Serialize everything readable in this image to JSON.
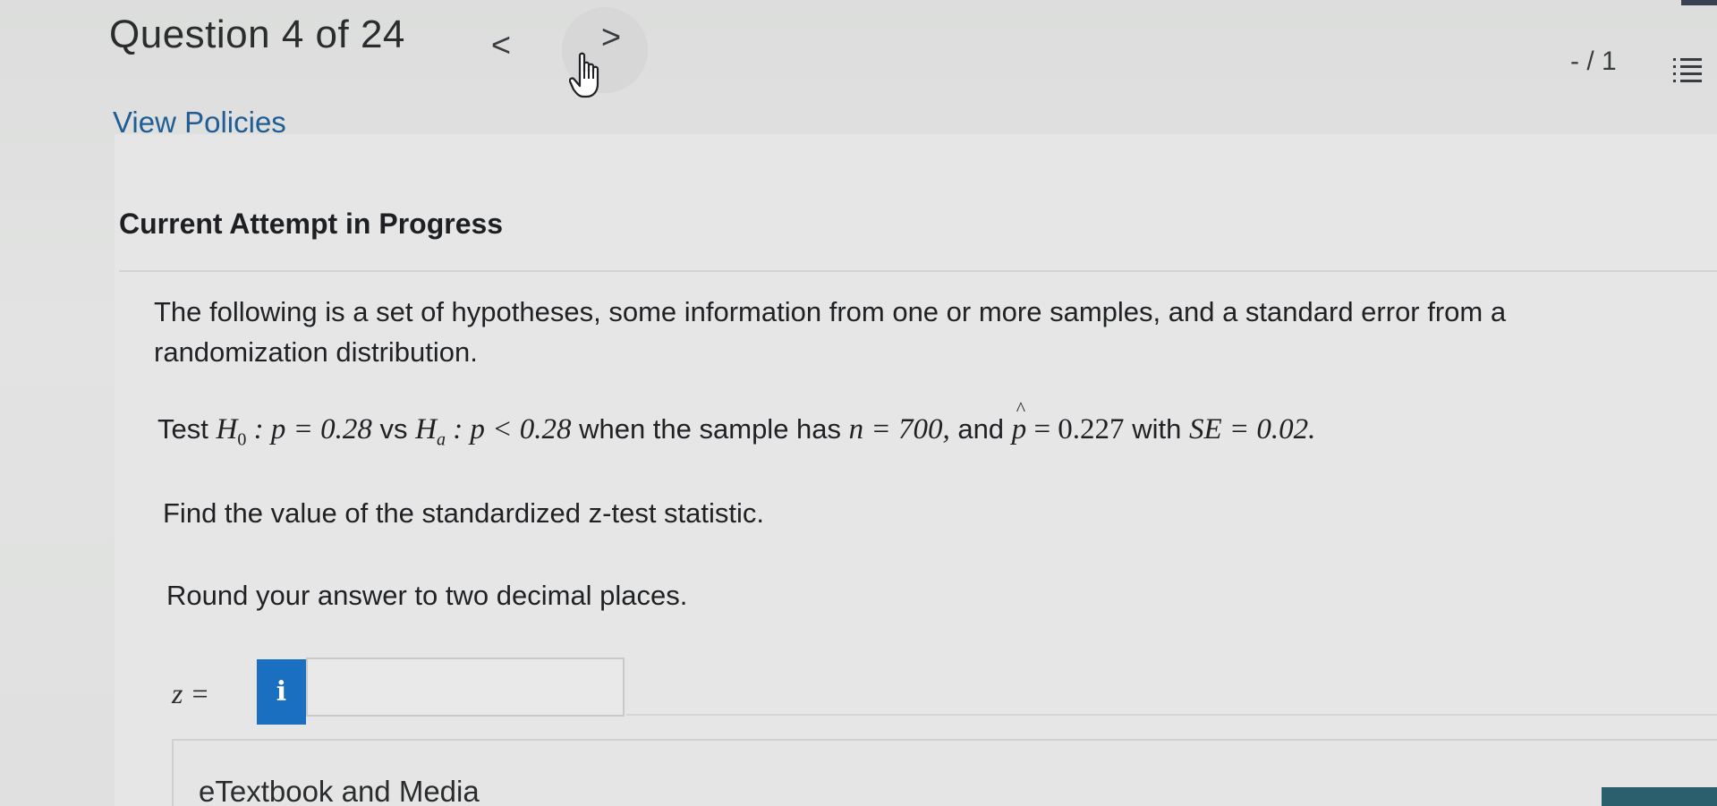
{
  "header": {
    "question_label": "Question 4 of 24",
    "prev_label": "<",
    "next_label": ">",
    "score": "- / 1",
    "menu_icon": "list-icon"
  },
  "links": {
    "view_policies": "View Policies"
  },
  "attempt": {
    "heading": "Current Attempt in Progress"
  },
  "question": {
    "intro": "The following is a set of hypotheses, some information from one or more samples, and a standard error from a randomization distribution.",
    "test_prefix": "Test",
    "h0_symbol": "H",
    "h0_sub": "0",
    "h0_expr": ": p = 0.28",
    "vs": "vs",
    "ha_symbol": "H",
    "ha_sub": "a",
    "ha_expr": ": p < 0.28",
    "when_text": "when the sample has",
    "n_expr": "n = 700,",
    "and_text": "and",
    "phat_symbol": "p",
    "phat_expr": "= 0.227",
    "with_text": "with",
    "se_expr": "SE = 0.02.",
    "find_text": "Find the value of the standardized z-test statistic.",
    "round_text": "Round your answer to two decimal places."
  },
  "answer": {
    "label": "z =",
    "info_icon_text": "i",
    "value": "",
    "placeholder": ""
  },
  "resources": {
    "etextbook_label": "eTextbook and Media"
  },
  "colors": {
    "info_button": "#1a6fc0",
    "link": "#1f5d95"
  }
}
